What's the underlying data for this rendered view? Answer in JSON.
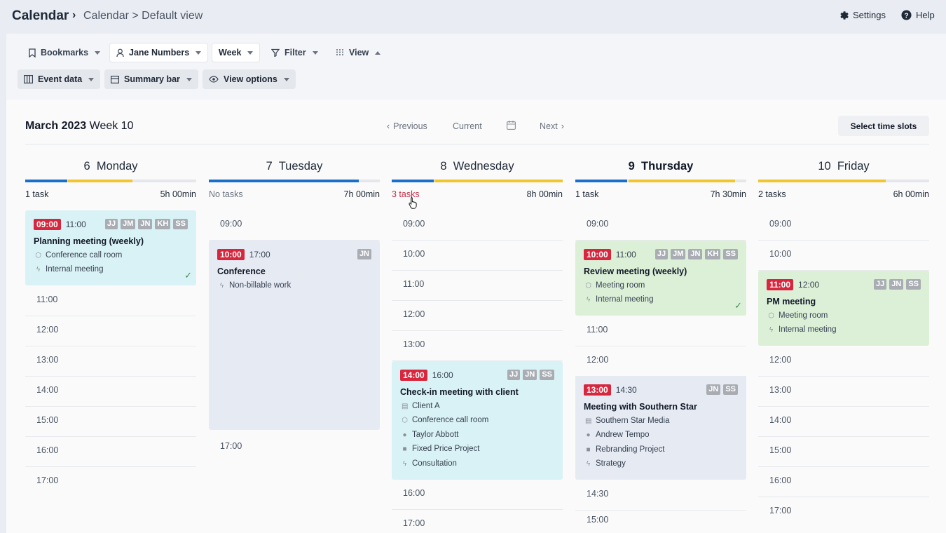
{
  "header": {
    "app_title": "Calendar",
    "breadcrumb_sep": "›",
    "breadcrumb": "Calendar > Default view",
    "settings": "Settings",
    "help": "Help"
  },
  "toolbar": {
    "bookmarks": "Bookmarks",
    "user": "Jane Numbers",
    "range": "Week",
    "filter": "Filter",
    "view": "View",
    "event_data": "Event data",
    "summary_bar": "Summary bar",
    "view_options": "View options"
  },
  "week": {
    "month_year": "March 2023",
    "week_label": "Week 10",
    "previous": "Previous",
    "current": "Current",
    "next": "Next",
    "select_slots": "Select time slots"
  },
  "colors": {
    "blue": "#1a6fc9",
    "yellow": "#f2c52b",
    "start_red": "#d7263d"
  },
  "days": [
    {
      "num": "6",
      "name": "Monday",
      "tasks": "1 task",
      "hours": "5h 00min",
      "slots": [
        "11:00",
        "12:00",
        "13:00",
        "14:00",
        "15:00",
        "16:00",
        "17:00"
      ],
      "event": {
        "start": "09:00",
        "end": "11:00",
        "avatars": [
          "JJ",
          "JM",
          "JN",
          "KH",
          "SS"
        ],
        "title": "Planning meeting (weekly)",
        "lines": [
          "Conference call room",
          "Internal meeting"
        ]
      }
    },
    {
      "num": "7",
      "name": "Tuesday",
      "tasks": "No tasks",
      "hours": "7h 00min",
      "slots": [
        "09:00",
        "17:00"
      ],
      "event": {
        "start": "10:00",
        "end": "17:00",
        "avatars": [
          "JN"
        ],
        "title": "Conference",
        "lines": [
          "Non-billable work"
        ]
      }
    },
    {
      "num": "8",
      "name": "Wednesday",
      "tasks": "3 tasks",
      "hours": "8h 00min",
      "slots": [
        "09:00",
        "10:00",
        "11:00",
        "12:00",
        "13:00",
        "16:00",
        "17:00"
      ],
      "event": {
        "start": "14:00",
        "end": "16:00",
        "avatars": [
          "JJ",
          "JN",
          "SS"
        ],
        "title": "Check-in meeting with client",
        "lines": [
          "Client A",
          "Conference call room",
          "Taylor Abbott",
          "Fixed Price Project",
          "Consultation"
        ]
      }
    },
    {
      "num": "9",
      "name": "Thursday",
      "tasks": "1 task",
      "hours": "7h 30min",
      "slots": [
        "09:00",
        "11:00",
        "12:00",
        "14:30",
        "15:00"
      ],
      "event": {
        "start": "10:00",
        "end": "11:00",
        "avatars": [
          "JJ",
          "JM",
          "JN",
          "KH",
          "SS"
        ],
        "title": "Review meeting (weekly)",
        "lines": [
          "Meeting room",
          "Internal meeting"
        ]
      },
      "event2": {
        "start": "13:00",
        "end": "14:30",
        "avatars": [
          "JN",
          "SS"
        ],
        "title": "Meeting with Southern Star",
        "lines": [
          "Southern Star Media",
          "Andrew Tempo",
          "Rebranding Project",
          "Strategy"
        ]
      }
    },
    {
      "num": "10",
      "name": "Friday",
      "tasks": "2 tasks",
      "hours": "6h 00min",
      "slots": [
        "09:00",
        "10:00",
        "12:00",
        "13:00",
        "14:00",
        "15:00",
        "16:00",
        "17:00"
      ],
      "event": {
        "start": "11:00",
        "end": "12:00",
        "avatars": [
          "JJ",
          "JN",
          "SS"
        ],
        "title": "PM meeting",
        "lines": [
          "Meeting room",
          "Internal meeting"
        ]
      }
    }
  ]
}
